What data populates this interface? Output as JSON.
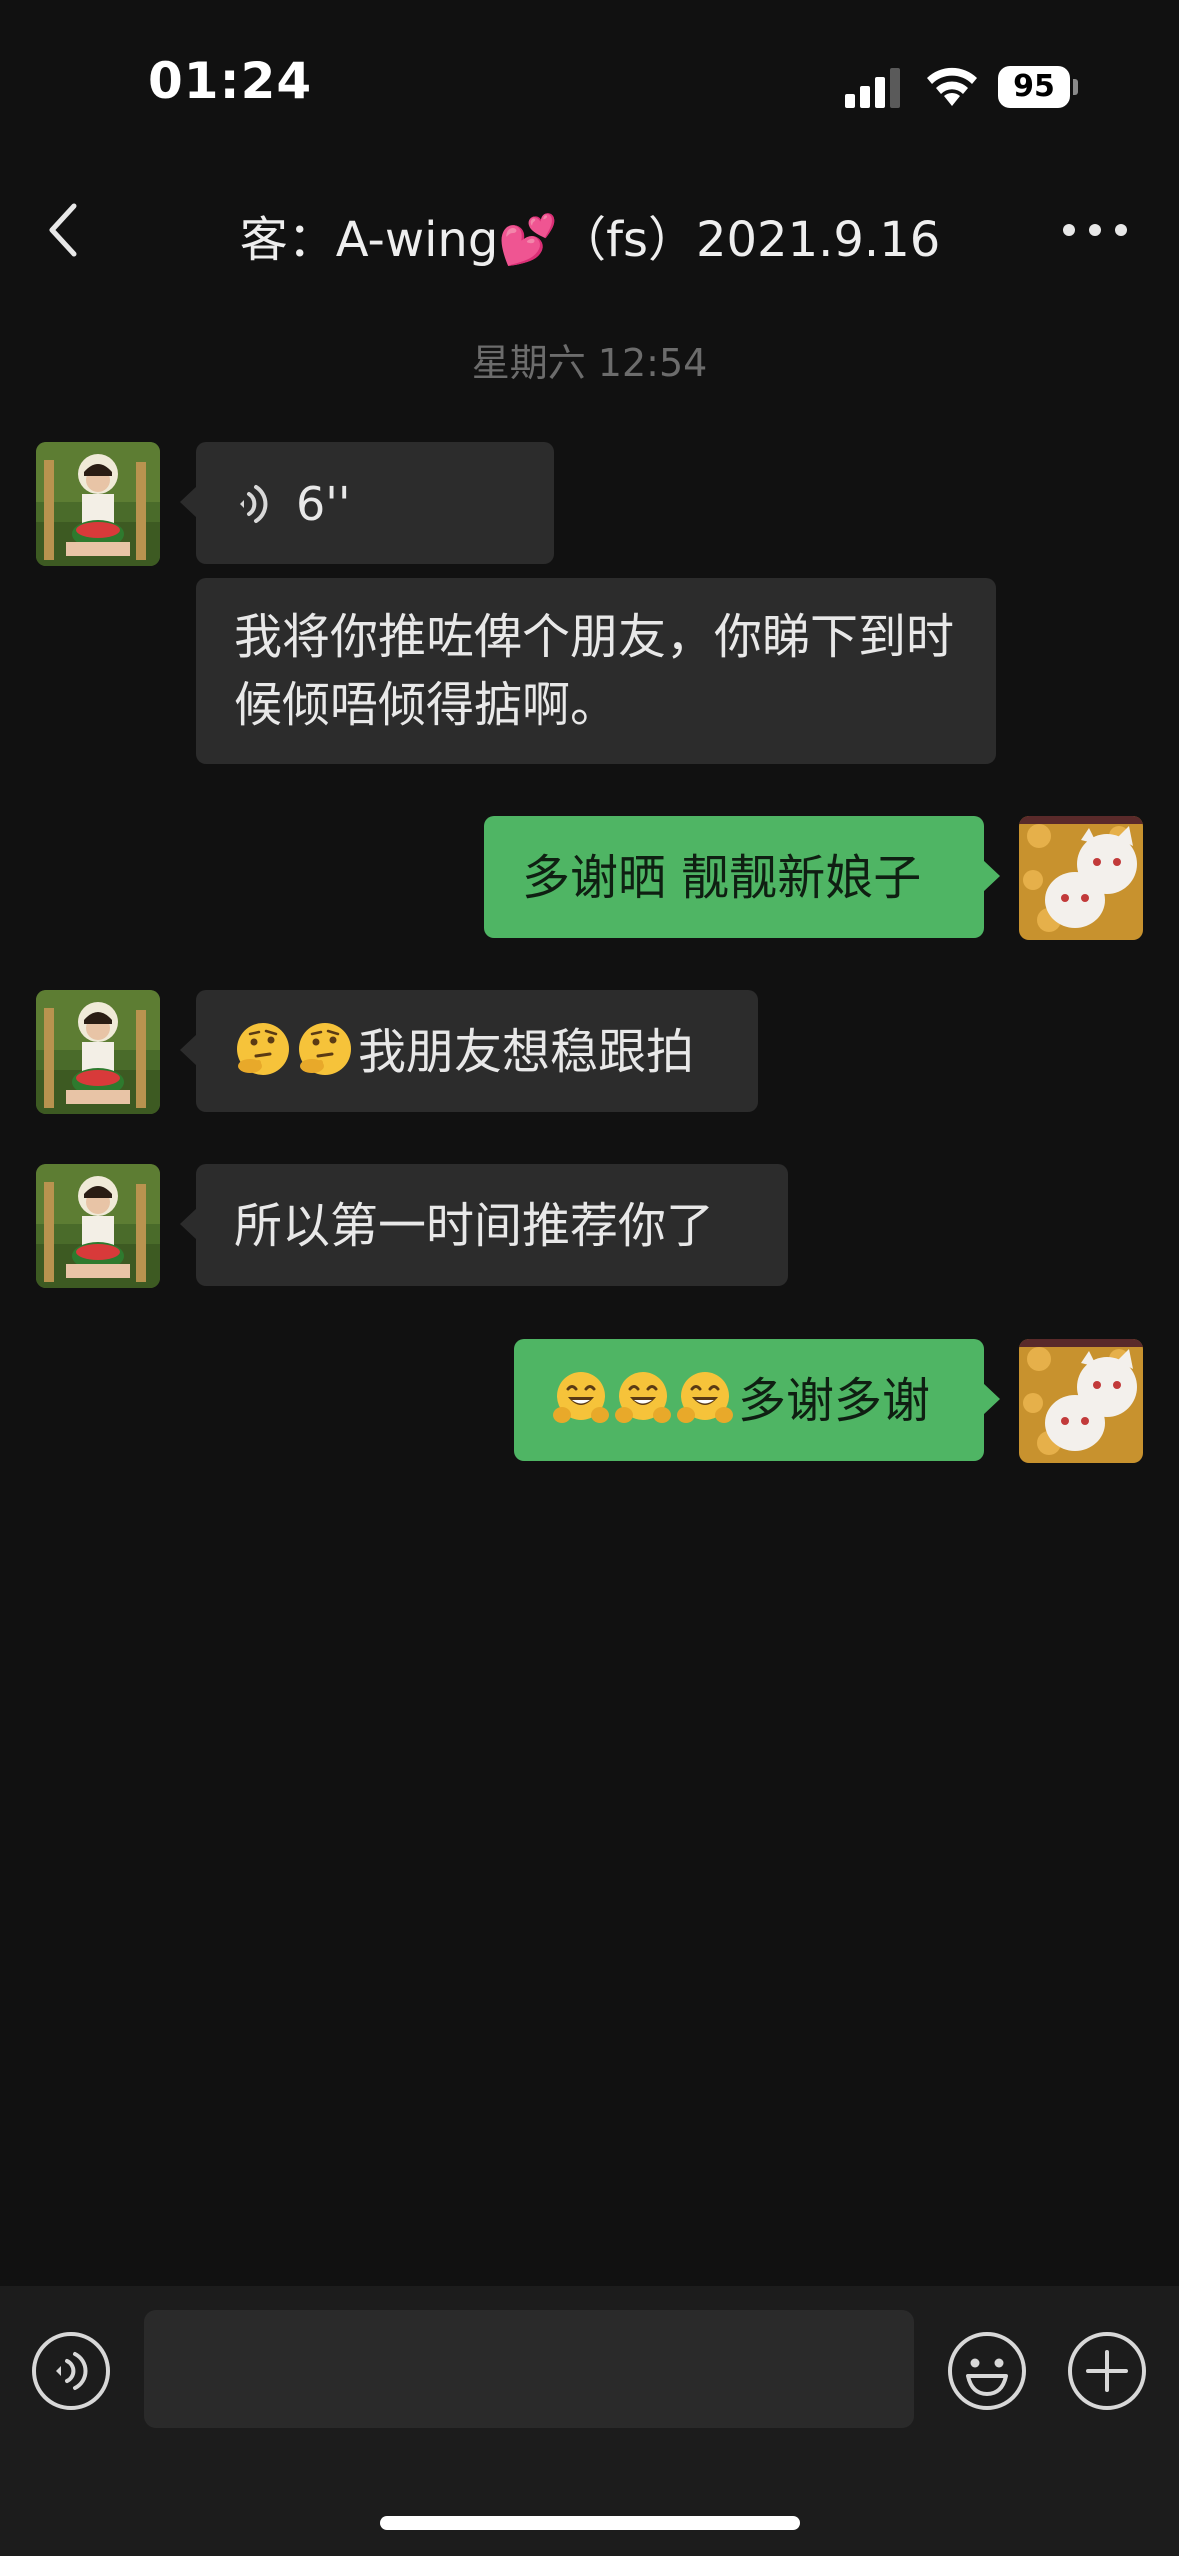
{
  "status_bar": {
    "time": "01:24",
    "battery": "95",
    "icons": [
      "signal-icon",
      "wifi-icon",
      "battery-icon"
    ]
  },
  "nav": {
    "title": "客：A-wing💕（fs）2021.9.16",
    "icons": [
      "back-chevron-icon",
      "more-dots-icon"
    ]
  },
  "chat": {
    "timestamp": "星期六 12:54",
    "messages": [
      {
        "side": "in",
        "type": "voice",
        "duration": "6''"
      },
      {
        "side": "in",
        "type": "text",
        "text": "我将你推咗俾个朋友，你睇下到时候倾唔倾得掂啊。"
      },
      {
        "side": "out",
        "type": "text",
        "text": "多谢晒 靓靓新娘子"
      },
      {
        "side": "in",
        "type": "text",
        "emoji": [
          "thinking-face-emoji",
          "thinking-face-emoji"
        ],
        "text": "我朋友想稳跟拍"
      },
      {
        "side": "in",
        "type": "text",
        "text": "所以第一时间推荐你了"
      },
      {
        "side": "out",
        "type": "text",
        "emoji": [
          "hugging-face-emoji",
          "hugging-face-emoji",
          "hugging-face-emoji"
        ],
        "text": "多谢多谢"
      }
    ]
  },
  "input_bar": {
    "placeholder": "",
    "icons": [
      "voice-toggle-icon",
      "emoji-icon",
      "plus-icon"
    ]
  },
  "colors": {
    "background": "#111111",
    "incoming_bubble": "#2c2c2c",
    "outgoing_bubble": "#4fb564",
    "input_bar": "#1c1c1c"
  }
}
